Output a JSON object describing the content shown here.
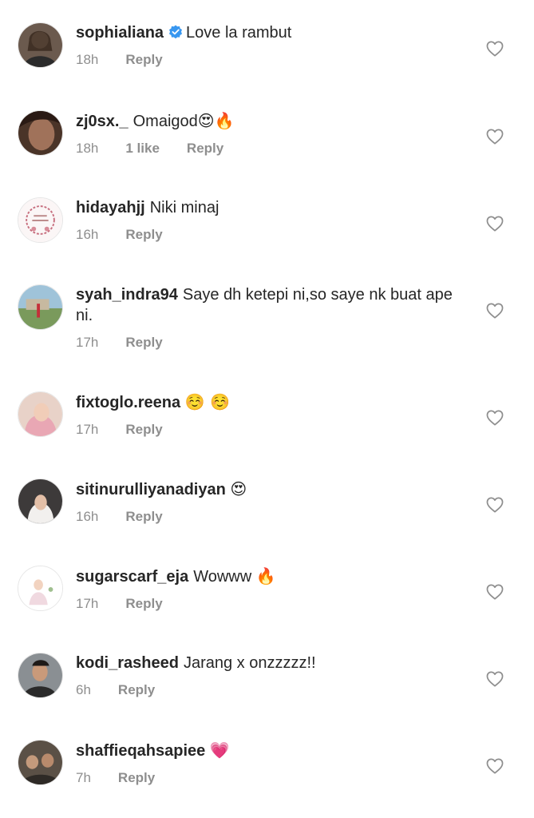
{
  "comments": [
    {
      "username": "sophialiana",
      "verified": true,
      "text": "Love la rambut",
      "emoji": "",
      "time": "18h",
      "likes": "",
      "reply": "Reply"
    },
    {
      "username": "zj0sx._",
      "verified": false,
      "text": "Omaigod",
      "emoji": "😍🔥",
      "time": "18h",
      "likes": "1 like",
      "reply": "Reply"
    },
    {
      "username": "hidayahjj",
      "verified": false,
      "text": "Niki minaj",
      "emoji": "",
      "time": "16h",
      "likes": "",
      "reply": "Reply"
    },
    {
      "username": "syah_indra94",
      "verified": false,
      "text": "Saye dh ketepi ni,so saye nk buat ape ni.",
      "emoji": "",
      "time": "17h",
      "likes": "",
      "reply": "Reply"
    },
    {
      "username": "fixtoglo.reena",
      "verified": false,
      "text": "",
      "emoji": "☺️ ☺️",
      "time": "17h",
      "likes": "",
      "reply": "Reply"
    },
    {
      "username": "sitinurulliyanadiyan",
      "verified": false,
      "text": "",
      "emoji": "😍",
      "time": "16h",
      "likes": "",
      "reply": "Reply"
    },
    {
      "username": "sugarscarf_eja",
      "verified": false,
      "text": "Wowww",
      "emoji": "🔥",
      "time": "17h",
      "likes": "",
      "reply": "Reply"
    },
    {
      "username": "kodi_rasheed",
      "verified": false,
      "text": "Jarang x onzzzzz!!",
      "emoji": "",
      "time": "6h",
      "likes": "",
      "reply": "Reply"
    },
    {
      "username": "shaffieqahsapiee",
      "verified": false,
      "text": "",
      "emoji": "💗",
      "time": "7h",
      "likes": "",
      "reply": "Reply"
    }
  ],
  "colors": {
    "text": "#262626",
    "meta": "#8e8e8e",
    "verified": "#3897f0",
    "heart_stroke": "#8e8e8e"
  },
  "icons": {
    "like": "heart-outline-icon",
    "verified": "verified-badge-icon"
  }
}
